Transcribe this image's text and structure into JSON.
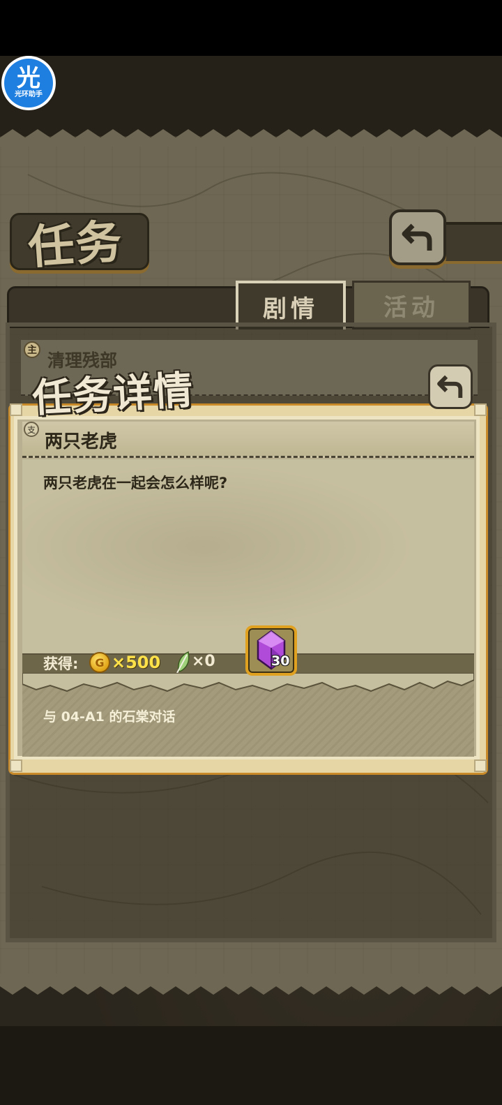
{
  "overlay": {
    "logo_char": "光",
    "logo_text": "光环助手"
  },
  "header": {
    "title": "任务"
  },
  "tabs": [
    {
      "label": "剧情",
      "active": true
    },
    {
      "label": "活动",
      "active": false
    }
  ],
  "mission_list": [
    {
      "badge": "主",
      "title": "清理残部"
    }
  ],
  "detail": {
    "heading": "任务详情",
    "task_badge": "支",
    "task_name": "两只老虎",
    "description": "两只老虎在一起会怎么样呢?",
    "rewards": {
      "label": "获得:",
      "coin_symbol": "G",
      "coin_amount": "×500",
      "feather_amount": "×0",
      "gem_count": "30"
    },
    "target": "与 04-A1 的石棠对话"
  },
  "colors": {
    "accent_orange": "#c98a2a",
    "coin_yellow": "#ffe24a",
    "parchment": "#c6bf9f",
    "frame_dark": "#3a3428",
    "gem_purple": "#b04ad8"
  },
  "icons": [
    "back-arrow-icon",
    "coin-icon",
    "feather-icon",
    "gem-icon"
  ]
}
